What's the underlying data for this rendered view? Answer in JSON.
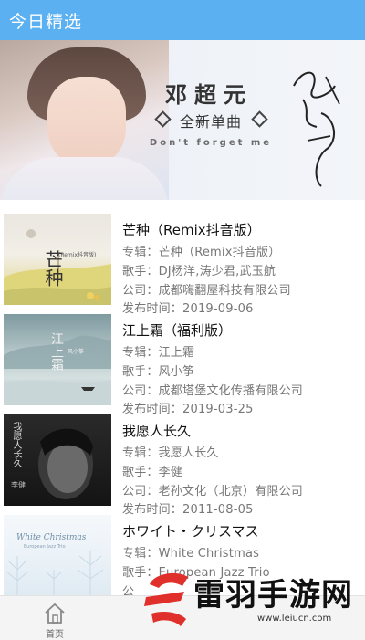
{
  "header": {
    "title": "今日精选"
  },
  "banner": {
    "artist": "邓超元",
    "subtitle": "全新单曲",
    "tagline": "Don't forget me"
  },
  "songs": [
    {
      "title": "芒种（Remix抖音版）",
      "album": "专辑：芒种（Remix抖音版）",
      "singer": "歌手：DJ杨洋,涛少君,武玉航",
      "company": "公司：成都嗨翻屋科技有限公司",
      "date": "发布时间：2019-09-06",
      "cover_text": "芒种",
      "cover_small": "(Remix抖音版)"
    },
    {
      "title": "江上霜（福利版）",
      "album": "专辑：江上霜",
      "singer": "歌手：风小筝",
      "company": "公司：成都塔堡文化传播有限公司",
      "date": "发布时间：2019-03-25",
      "cover_text": "江上霜",
      "cover_small": "风小筝"
    },
    {
      "title": "我愿人长久",
      "album": "专辑：我愿人长久",
      "singer": "歌手：李健",
      "company": "公司：老孙文化（北京）有限公司",
      "date": "发布时间：2011-08-05",
      "cover_text": "我愿人长久",
      "cover_small": "李健"
    },
    {
      "title": "ホワイト・クリスマス",
      "album": "专辑：White Christmas",
      "singer": "歌手：European Jazz Trio",
      "company": "公",
      "date": "",
      "cover_text": "White Christmas",
      "cover_small": "European Jazz Trio"
    }
  ],
  "bottom_nav": {
    "home_label": "首页"
  },
  "watermark": {
    "text": "雷羽手游网",
    "url": "www.leiucn.com"
  },
  "colors": {
    "header": "#5ab0f0",
    "watermark_red": "#e0302b"
  }
}
